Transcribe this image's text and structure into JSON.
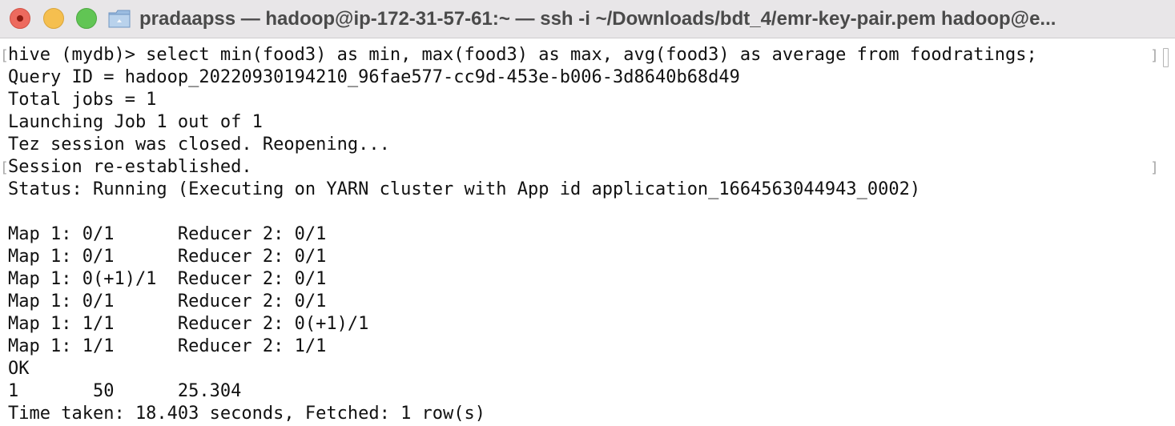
{
  "window": {
    "title": "pradaapss — hadoop@ip-172-31-57-61:~ — ssh -i ~/Downloads/bdt_4/emr-key-pair.pem hadoop@e...",
    "controls": {
      "close_color": "#ed6a5e",
      "minimize_color": "#f5bf4f",
      "zoom_color": "#61c554"
    },
    "title_icon": "folder-icon"
  },
  "terminal": {
    "lines": [
      "hive (mydb)> select min(food3) as min, max(food3) as max, avg(food3) as average from foodratings;",
      "Query ID = hadoop_20220930194210_96fae577-cc9d-453e-b006-3d8640b68d49",
      "Total jobs = 1",
      "Launching Job 1 out of 1",
      "Tez session was closed. Reopening...",
      "Session re-established.",
      "Status: Running (Executing on YARN cluster with App id application_1664563044943_0002)",
      "",
      "Map 1: 0/1      Reducer 2: 0/1",
      "Map 1: 0/1      Reducer 2: 0/1",
      "Map 1: 0(+1)/1  Reducer 2: 0/1",
      "Map 1: 0/1      Reducer 2: 0/1",
      "Map 1: 1/1      Reducer 2: 0(+1)/1",
      "Map 1: 1/1      Reducer 2: 1/1",
      "OK",
      "1       50      25.304",
      "Time taken: 18.403 seconds, Fetched: 1 row(s)"
    ],
    "bracket_marks": {
      "left": "[",
      "right": "]"
    }
  }
}
